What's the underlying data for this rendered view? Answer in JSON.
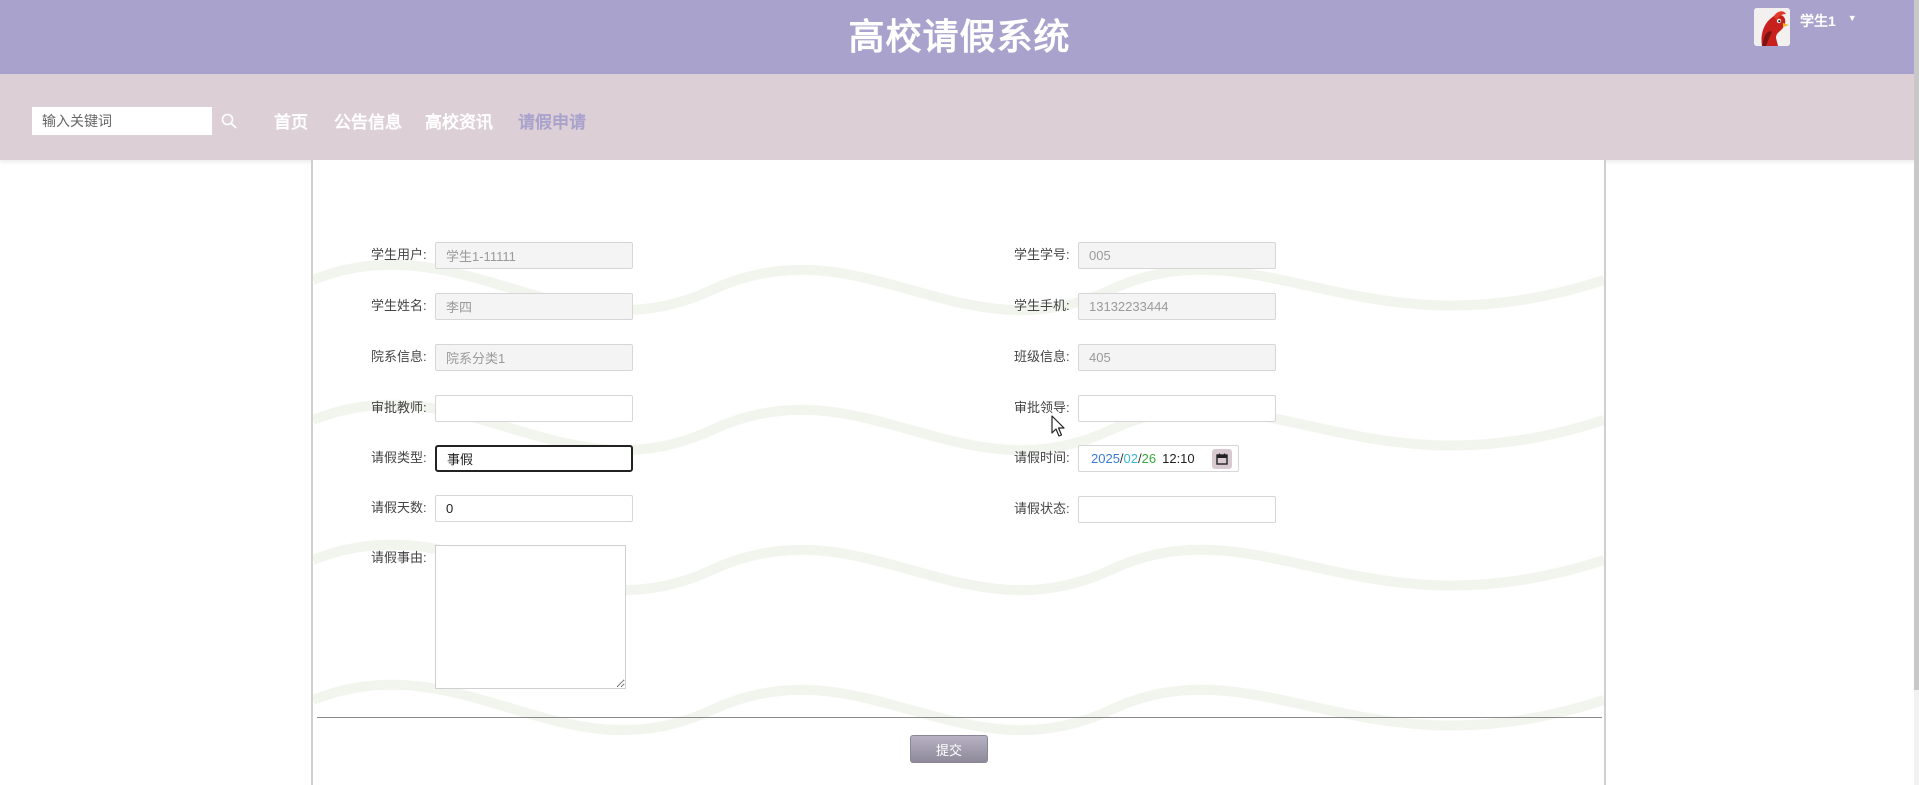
{
  "header": {
    "title": "高校请假系统",
    "username": "学生1",
    "caret": "▼"
  },
  "nav": {
    "search_placeholder": "输入关键词",
    "items": [
      {
        "label": "首页",
        "active": false
      },
      {
        "label": "公告信息",
        "active": false
      },
      {
        "label": "高校资讯",
        "active": false
      },
      {
        "label": "请假申请",
        "active": true
      }
    ]
  },
  "form": {
    "student_user": {
      "label": "学生用户:",
      "value": "学生1-11111"
    },
    "student_no": {
      "label": "学生学号:",
      "value": "005"
    },
    "student_name": {
      "label": "学生姓名:",
      "value": "李四"
    },
    "student_phone": {
      "label": "学生手机:",
      "value": "13132233444"
    },
    "department": {
      "label": "院系信息:",
      "value": "院系分类1"
    },
    "class_info": {
      "label": "班级信息:",
      "value": "405"
    },
    "approve_teacher": {
      "label": "审批教师:",
      "value": ""
    },
    "approve_leader": {
      "label": "审批领导:",
      "value": ""
    },
    "leave_type": {
      "label": "请假类型:",
      "value": "事假"
    },
    "leave_time": {
      "label": "请假时间:",
      "year": "2025",
      "month": "02",
      "day": "26",
      "time": "12:10",
      "sep": "/"
    },
    "leave_days": {
      "label": "请假天数:",
      "value": "0"
    },
    "leave_status": {
      "label": "请假状态:",
      "value": ""
    },
    "leave_reason": {
      "label": "请假事由:",
      "value": ""
    },
    "submit_label": "提交"
  },
  "colors": {
    "header_bg": "#a8a2cc",
    "nav_bg": "#dccfd6",
    "nav_active": "#a8a2cc"
  }
}
